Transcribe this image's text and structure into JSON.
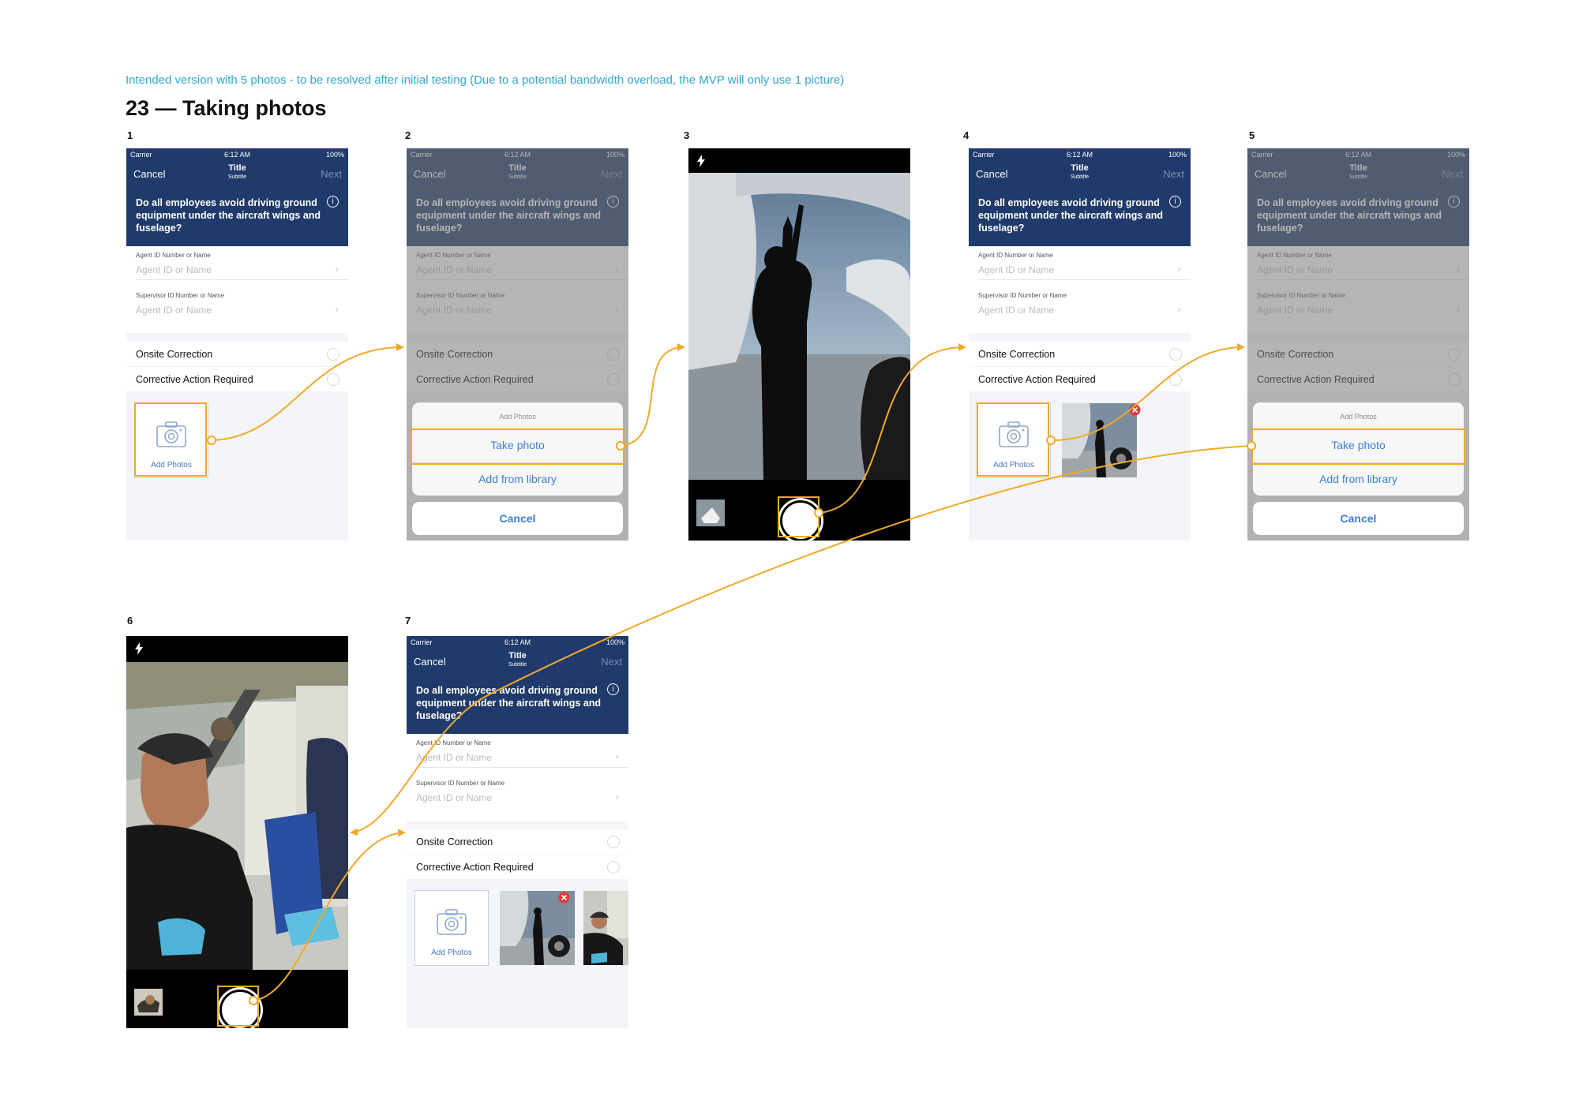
{
  "header": {
    "note": "Intended version with 5 photos - to be resolved after initial testing (Due to a potential bandwidth overload, the MVP will only use 1 picture)",
    "title": "23 — Taking photos"
  },
  "screen_numbers": [
    "1",
    "2",
    "3",
    "4",
    "5",
    "6",
    "7"
  ],
  "phone": {
    "status": {
      "carrier": "Carrier",
      "time": "6:12 AM",
      "battery": "100%"
    },
    "nav": {
      "cancel": "Cancel",
      "title": "Title",
      "subtitle": "Subtitle",
      "next": "Next"
    },
    "question": "Do all employees avoid driving ground equipment under the aircraft wings and fuselage?",
    "info_glyph": "i",
    "fields": {
      "agent_label": "Agent ID Number or Name",
      "agent_placeholder": "Agent ID or Name",
      "supervisor_label": "Supervisor ID Number or Name",
      "supervisor_placeholder": "Agent ID or Name"
    },
    "options": [
      "Onsite Correction",
      "Corrective Action Required"
    ],
    "add_photos": "Add Photos"
  },
  "action_sheet": {
    "header": "Add Photos",
    "take_photo": "Take photo",
    "add_from_library": "Add from library",
    "cancel": "Cancel"
  },
  "icons": [
    "signal-icon",
    "wifi-icon",
    "battery-icon",
    "info-icon",
    "chevron-right-icon",
    "camera-icon",
    "flash-icon",
    "shutter-icon",
    "remove-photo-icon"
  ],
  "colors": {
    "navy": "#1f3a6b",
    "accent_link": "#3b7fd6",
    "annotation": "#f2a92a",
    "note_text": "#2fa8da"
  }
}
